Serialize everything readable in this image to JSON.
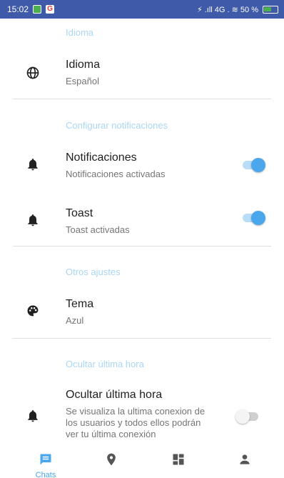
{
  "status_bar": {
    "time": "15:02",
    "right_text": "⚡ .ıll 4G . ≋ 50 %"
  },
  "sections": {
    "idioma_header": "Idioma",
    "notificaciones_header": "Configurar notificaciones",
    "otros_header": "Otros ajustes",
    "ocultar_header": "Ocultar última hora"
  },
  "rows": {
    "idioma": {
      "title": "Idioma",
      "subtitle": "Español",
      "icon": "globe-icon"
    },
    "notificaciones": {
      "title": "Notificaciones",
      "subtitle": "Notificaciones activadas",
      "icon": "bell-icon",
      "enabled": true
    },
    "toast": {
      "title": "Toast",
      "subtitle": "Toast activadas",
      "icon": "bell-icon",
      "enabled": true
    },
    "tema": {
      "title": "Tema",
      "subtitle": "Azul",
      "icon": "palette-icon"
    },
    "ocultar": {
      "title": "Ocultar última hora",
      "subtitle_lines": [
        "Se visualiza la ultima conexion de",
        "los usuarios y todos ellos podrán",
        "ver tu última conexión"
      ],
      "icon": "bell-icon",
      "enabled": false
    }
  },
  "bottom_nav": {
    "items": [
      {
        "label": "Chats",
        "icon": "chat-icon",
        "active": true
      },
      {
        "label": "",
        "icon": "location-icon",
        "active": false
      },
      {
        "label": "",
        "icon": "dashboard-icon",
        "active": false
      },
      {
        "label": "",
        "icon": "person-icon",
        "active": false
      }
    ]
  },
  "colors": {
    "accent": "#4aa7ec",
    "section_header": "#aad6f5",
    "status_bar": "#3f5aa8"
  }
}
